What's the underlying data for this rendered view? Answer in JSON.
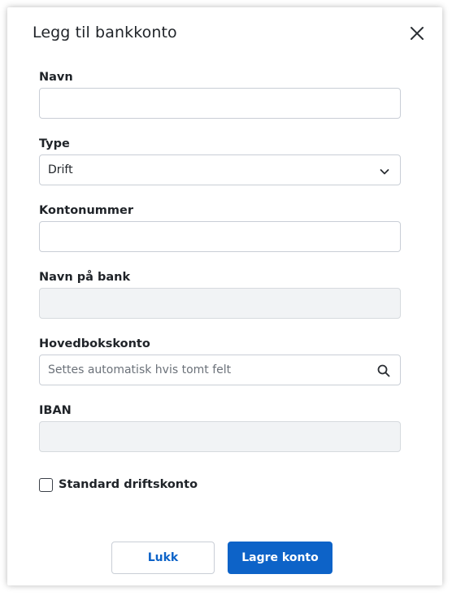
{
  "dialog": {
    "title": "Legg til bankkonto",
    "close_icon": "close-icon"
  },
  "fields": {
    "navn": {
      "label": "Navn",
      "value": ""
    },
    "type": {
      "label": "Type",
      "value": "Drift"
    },
    "kontonummer": {
      "label": "Kontonummer",
      "value": ""
    },
    "navn_pa_bank": {
      "label": "Navn på bank",
      "value": ""
    },
    "hovedbokskonto": {
      "label": "Hovedbokskonto",
      "placeholder": "Settes automatisk hvis tomt felt",
      "icon": "search-icon"
    },
    "iban": {
      "label": "IBAN",
      "value": ""
    }
  },
  "checkbox": {
    "label": "Standard driftskonto",
    "checked": false
  },
  "buttons": {
    "close_label": "Lukk",
    "save_label": "Lagre konto"
  },
  "colors": {
    "primary": "#0d63c8",
    "disabled_bg": "#f1f3f5",
    "border": "#c9ced6"
  }
}
